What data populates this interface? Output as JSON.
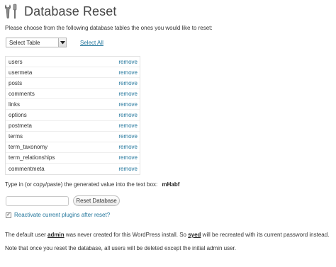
{
  "header": {
    "title": "Database Reset"
  },
  "intro_text": "Please choose from the following database tables the ones you would like to reset:",
  "select": {
    "value": "Select Table",
    "select_all_label": "Select All"
  },
  "tables": {
    "remove_label": "remove",
    "rows": [
      {
        "name": "users"
      },
      {
        "name": "usermeta"
      },
      {
        "name": "posts"
      },
      {
        "name": "comments"
      },
      {
        "name": "links"
      },
      {
        "name": "options"
      },
      {
        "name": "postmeta"
      },
      {
        "name": "terms"
      },
      {
        "name": "term_taxonomy"
      },
      {
        "name": "term_relationships"
      },
      {
        "name": "commentmeta"
      }
    ]
  },
  "confirm": {
    "instruction": "Type in (or copy/paste) the generated value into the text box:",
    "code": "mHabf",
    "input_value": "",
    "button_label": "Reset Database"
  },
  "reactivate": {
    "checked": true,
    "check_mark": "✓",
    "label": "Reactivate current plugins after reset?"
  },
  "default_user": {
    "part1": "The default user ",
    "admin": "admin",
    "part2": " was never created for this WordPress install. So ",
    "user": "syed",
    "part3": " will be recreated with its current password instead."
  },
  "note": "Note that once you reset the database, all users will be deleted except the initial admin user.",
  "colors": {
    "link": "#21759b",
    "text": "#333333"
  }
}
